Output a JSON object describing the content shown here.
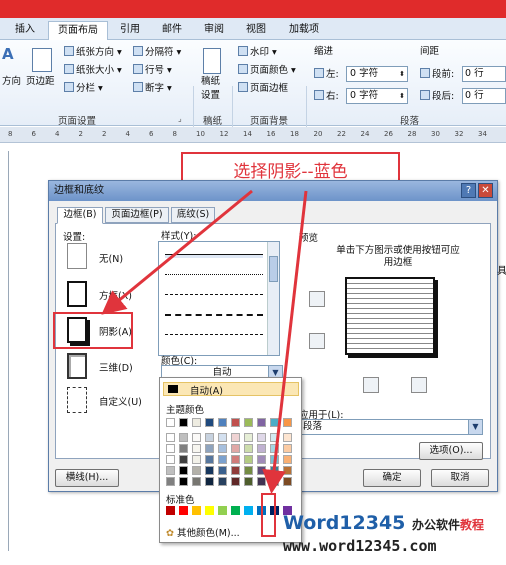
{
  "ribbon_tabs": [
    "插入",
    "页面布局",
    "引用",
    "邮件",
    "审阅",
    "视图",
    "加载项"
  ],
  "ribbon": {
    "text_direction": "方向",
    "margins": "页边距",
    "orientation": "纸张方向",
    "size": "纸张大小",
    "columns": "分栏",
    "breaks": "分隔符",
    "line_numbers": "行号",
    "hyphenation": "断字",
    "page_setup": "页面设置",
    "draft_paper_1": "稿纸",
    "draft_paper_2": "设置",
    "draft_paper_group": "稿纸",
    "watermark": "水印",
    "page_color": "页面颜色",
    "page_borders": "页面边框",
    "page_background": "页面背景",
    "indent_label": "缩进",
    "indent_left_label": "左:",
    "indent_left_value": "0 字符",
    "indent_right_label": "右:",
    "indent_right_value": "0 字符",
    "spacing_label": "间距",
    "spacing_before_label": "段前:",
    "spacing_before_value": "0 行",
    "spacing_after_label": "段后:",
    "spacing_after_value": "0 行",
    "paragraph_group": "段落"
  },
  "ruler_ticks": [
    "8",
    "6",
    "4",
    "2",
    "2",
    "4",
    "6",
    "8",
    "10",
    "12",
    "14",
    "16",
    "18",
    "20",
    "22",
    "24",
    "26",
    "28",
    "30",
    "32",
    "34"
  ],
  "callout": "选择阴影--蓝色",
  "dialog": {
    "title": "边框和底纹",
    "help": "?",
    "close": "✕",
    "tabs": [
      "边框(B)",
      "页面边框(P)",
      "底纹(S)"
    ],
    "settings_label": "设置:",
    "settings": [
      "无(N)",
      "方框(X)",
      "阴影(A)",
      "三维(D)",
      "自定义(U)"
    ],
    "style_label": "样式(Y):",
    "color_label": "颜色(C):",
    "color_value": "自动",
    "preview_label": "预览",
    "preview_hint": "单击下方图示或使用按钮可应用边框",
    "apply_to_label": "应用于(L):",
    "apply_to_value": "段落",
    "options_button": "选项(O)...",
    "hline_button": "横线(H)...",
    "ok_button": "确定",
    "cancel_button": "取消"
  },
  "color_popup": {
    "auto": "自动(A)",
    "theme_colors_label": "主题颜色",
    "standard_colors_label": "标准色",
    "more_colors": "其他颜色(M)...",
    "theme_top_row": [
      "#ffffff",
      "#000000",
      "#eeece1",
      "#1f497d",
      "#4f81bd",
      "#c0504d",
      "#9bbb59",
      "#8064a2",
      "#4bacc6",
      "#f79646"
    ],
    "standard_colors": [
      "#c00000",
      "#ff0000",
      "#ffc000",
      "#ffff00",
      "#92d050",
      "#00b050",
      "#00b0f0",
      "#0070c0",
      "#002060",
      "#7030a0"
    ]
  },
  "watermark": {
    "brand": "Word12345",
    "tagline_1": "办公软件",
    "tagline_2": "教程",
    "url": "www.word12345.com"
  }
}
